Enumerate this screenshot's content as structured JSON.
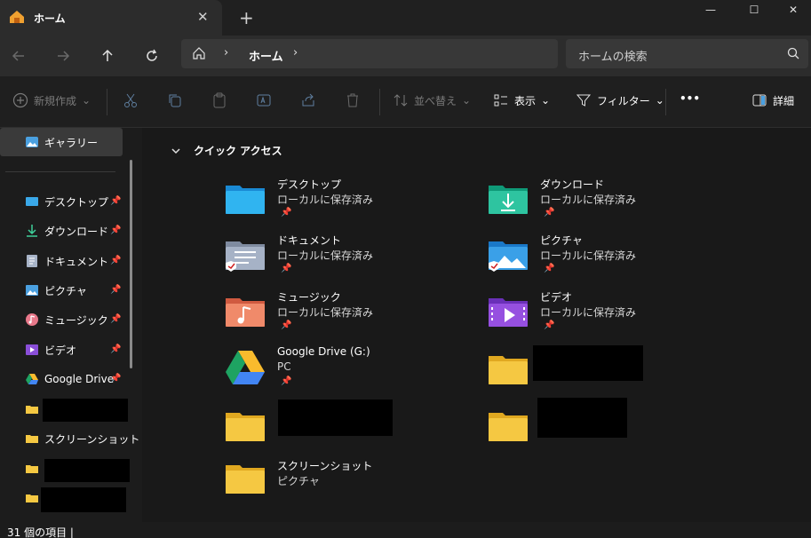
{
  "window": {
    "tab_title": "ホーム",
    "tab_close": "✕",
    "new_tab": "+",
    "controls": {
      "minimize": "—",
      "maximize": "☐",
      "close": "✕"
    }
  },
  "navigation": {
    "address_location": "ホーム",
    "address_separator": "›",
    "search_placeholder": "ホームの検索"
  },
  "toolbar": {
    "new_label": "新規作成",
    "sort_label": "並べ替え",
    "view_label": "表示",
    "filter_label": "フィルター",
    "more_label": "•••",
    "details_label": "詳細"
  },
  "sidebar": {
    "gallery": "ギャラリー",
    "items": [
      {
        "label": "デスクトップ",
        "pinned": true
      },
      {
        "label": "ダウンロード",
        "pinned": true
      },
      {
        "label": "ドキュメント",
        "pinned": true
      },
      {
        "label": "ピクチャ",
        "pinned": true
      },
      {
        "label": "ミュージック",
        "pinned": true
      },
      {
        "label": "ビデオ",
        "pinned": true
      },
      {
        "label": "Google Drive",
        "pinned": true
      },
      {
        "label": "スクリーンショット",
        "pinned": false
      }
    ]
  },
  "quick_access": {
    "header": "クイック アクセス",
    "folders": [
      {
        "name": "デスクトップ",
        "sub": "ローカルに保存済み"
      },
      {
        "name": "ダウンロード",
        "sub": "ローカルに保存済み"
      },
      {
        "name": "ドキュメント",
        "sub": "ローカルに保存済み"
      },
      {
        "name": "ピクチャ",
        "sub": "ローカルに保存済み"
      },
      {
        "name": "ミュージック",
        "sub": "ローカルに保存済み"
      },
      {
        "name": "ビデオ",
        "sub": "ローカルに保存済み"
      },
      {
        "name": "Google Drive (G:)",
        "sub": "PC"
      },
      {
        "name": "スクリーンショット",
        "sub": "ピクチャ"
      }
    ]
  },
  "status": {
    "item_count": "31 個の項目  |"
  },
  "colors": {
    "accent": "#0078d4",
    "folder_yellow": "#f5c842",
    "background": "#191919"
  }
}
